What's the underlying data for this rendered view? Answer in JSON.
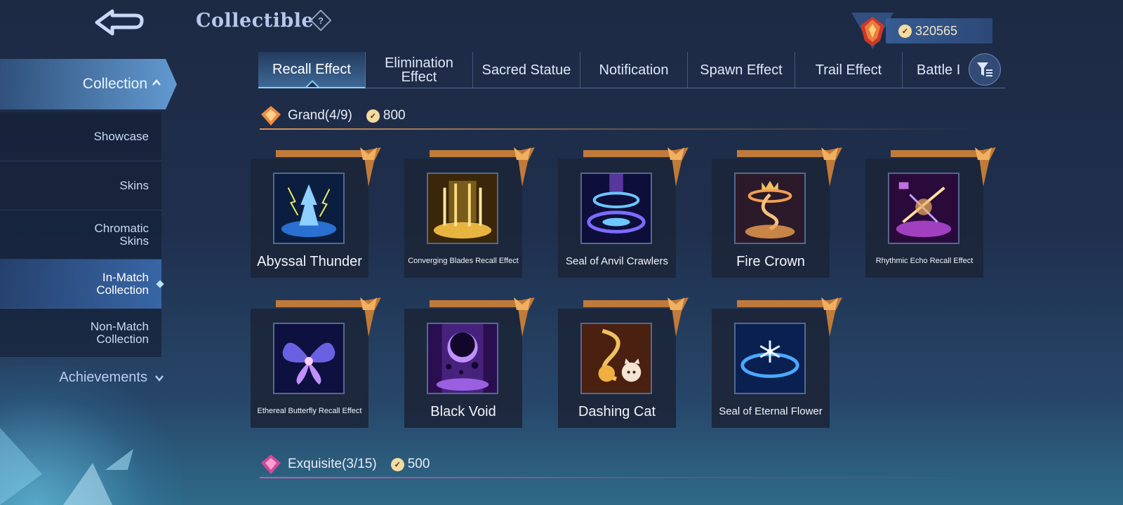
{
  "header": {
    "title": "Collectible",
    "currency_amount": "320565"
  },
  "sidebar": {
    "collection_label": "Collection",
    "items": [
      {
        "label": "Showcase",
        "active": false
      },
      {
        "label": "Skins",
        "active": false
      },
      {
        "label": "Chromatic\nSkins",
        "active": false
      },
      {
        "label": "In-Match\nCollection",
        "active": true
      },
      {
        "label": "Non-Match\nCollection",
        "active": false
      }
    ],
    "achievements_label": "Achievements"
  },
  "tabs": [
    {
      "label": "Recall Effect",
      "active": true
    },
    {
      "label": "Elimination\nEffect",
      "active": false
    },
    {
      "label": "Sacred Statue",
      "active": false
    },
    {
      "label": "Notification",
      "active": false
    },
    {
      "label": "Spawn Effect",
      "active": false
    },
    {
      "label": "Trail Effect",
      "active": false
    },
    {
      "label": "Battle I",
      "active": false
    }
  ],
  "sections": {
    "grand": {
      "label": "Grand(4/9)",
      "price": "800",
      "items": [
        {
          "name": "Abyssal Thunder",
          "icon": "lightning-demon-icon",
          "accent": "#5ab8ff"
        },
        {
          "name": "Converging Blades Recall Effect",
          "icon": "golden-blades-icon",
          "accent": "#e8b440"
        },
        {
          "name": "Seal of Anvil Crawlers",
          "icon": "blue-seal-ring-icon",
          "accent": "#6c7cff"
        },
        {
          "name": "Fire Crown",
          "icon": "fire-crown-icon",
          "accent": "#f0a050"
        },
        {
          "name": "Rhythmic Echo Recall Effect",
          "icon": "purple-echo-icon",
          "accent": "#c070e0"
        },
        {
          "name": "Ethereal Butterfly Recall Effect",
          "icon": "butterfly-icon",
          "accent": "#8080ff"
        },
        {
          "name": "Black Void",
          "icon": "black-void-moon-icon",
          "accent": "#9a60e0"
        },
        {
          "name": "Dashing Cat",
          "icon": "dashing-cat-icon",
          "accent": "#f0b040"
        },
        {
          "name": "Seal of Eternal Flower",
          "icon": "snowflake-seal-icon",
          "accent": "#60c8ff"
        }
      ]
    },
    "exquisite": {
      "label": "Exquisite(3/15)",
      "price": "500"
    }
  }
}
